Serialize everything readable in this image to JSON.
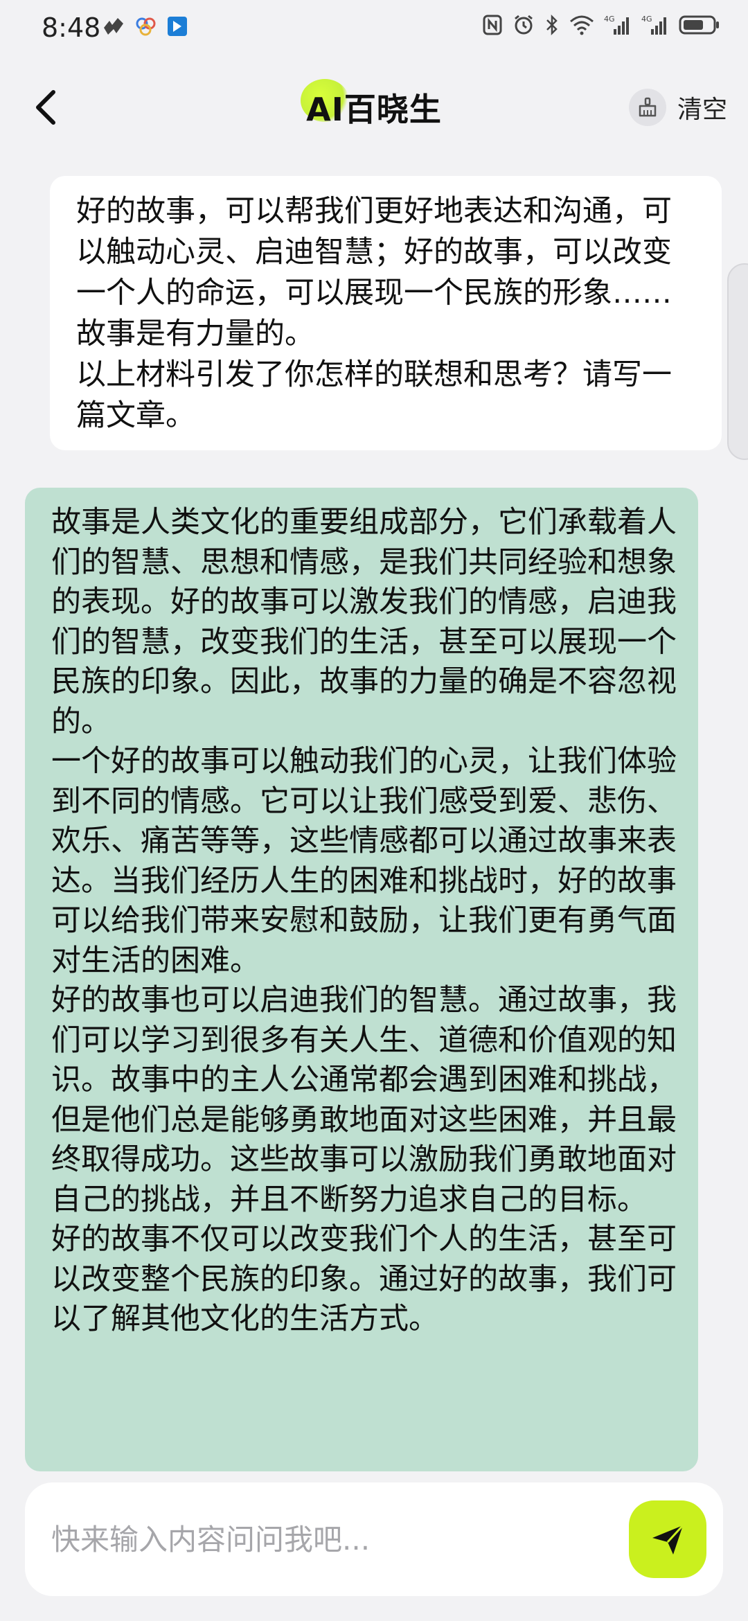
{
  "status_bar": {
    "time": "8:48",
    "network_label": "4G"
  },
  "header": {
    "title": "AI百晓生",
    "clear_label": "清空"
  },
  "messages": {
    "user": {
      "paragraphs": [
        "好的故事，可以帮我们更好地表达和沟通，可以触动心灵、启迪智慧；好的故事，可以改变一个人的命运，可以展现一个民族的形象……故事是有力量的。",
        "以上材料引发了你怎样的联想和思考？请写一篇文章。"
      ]
    },
    "bot": {
      "paragraphs": [
        "故事是人类文化的重要组成部分，它们承载着人们的智慧、思想和情感，是我们共同经验和想象的表现。好的故事可以激发我们的情感，启迪我们的智慧，改变我们的生活，甚至可以展现一个民族的印象。因此，故事的力量的确是不容忽视的。",
        "一个好的故事可以触动我们的心灵，让我们体验到不同的情感。它可以让我们感受到爱、悲伤、欢乐、痛苦等等，这些情感都可以通过故事来表达。当我们经历人生的困难和挑战时，好的故事可以给我们带来安慰和鼓励，让我们更有勇气面对生活的困难。",
        "好的故事也可以启迪我们的智慧。通过故事，我们可以学习到很多有关人生、道德和价值观的知识。故事中的主人公通常都会遇到困难和挑战，但是他们总是能够勇敢地面对这些困难，并且最终取得成功。这些故事可以激励我们勇敢地面对自己的挑战，并且不断努力追求自己的目标。",
        "好的故事不仅可以改变我们个人的生活，甚至可以改变整个民族的印象。通过好的故事，我们可以了解其他文化的生活方式。"
      ]
    }
  },
  "input": {
    "placeholder": "快来输入内容问问我吧..."
  },
  "colors": {
    "background": "#f2f2f4",
    "bot_bubble": "#bfe0d1",
    "accent": "#caf01e"
  }
}
